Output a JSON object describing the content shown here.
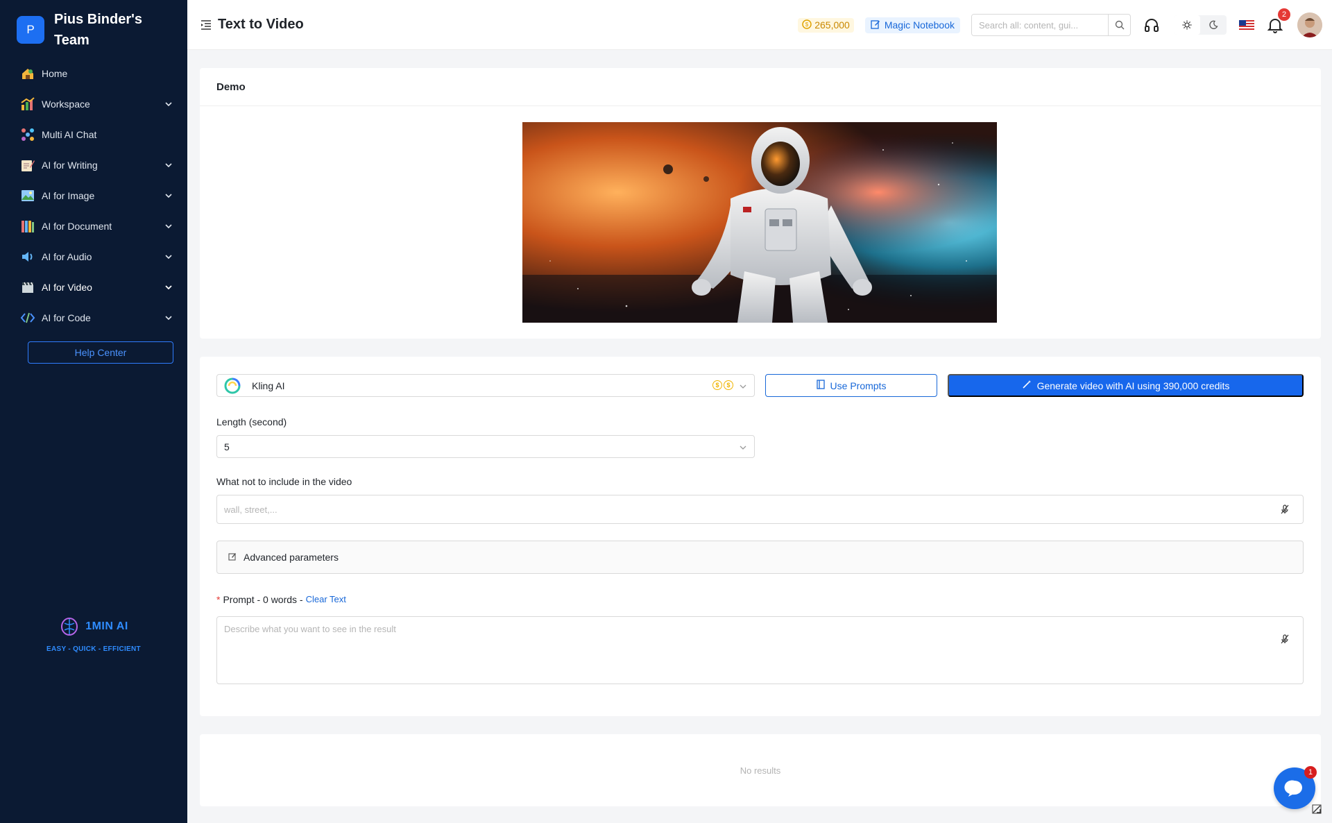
{
  "sidebar": {
    "team_initial": "P",
    "team_name": "Pius Binder's Team",
    "items": [
      {
        "label": "Home",
        "icon": "home-icon",
        "expandable": false
      },
      {
        "label": "Workspace",
        "icon": "workspace-icon",
        "expandable": true
      },
      {
        "label": "Multi AI Chat",
        "icon": "multi-chat-icon",
        "expandable": false
      },
      {
        "label": "AI for Writing",
        "icon": "writing-icon",
        "expandable": true
      },
      {
        "label": "AI for Image",
        "icon": "image-icon",
        "expandable": true
      },
      {
        "label": "AI for Document",
        "icon": "document-icon",
        "expandable": true
      },
      {
        "label": "AI for Audio",
        "icon": "audio-icon",
        "expandable": true
      },
      {
        "label": "AI for Video",
        "icon": "video-icon",
        "expandable": true,
        "active": true
      },
      {
        "label": "AI for Code",
        "icon": "code-icon",
        "expandable": true
      }
    ],
    "help_label": "Help Center",
    "brand_name": "1MIN AI",
    "brand_tagline": "EASY - QUICK - EFFICIENT"
  },
  "header": {
    "title": "Text to Video",
    "credits": "265,000",
    "notebook_label": "Magic Notebook",
    "search_placeholder": "Search all: content, gui...",
    "notification_count": "2"
  },
  "demo": {
    "title": "Demo",
    "image_alt": "astronaut floating in colorful nebula"
  },
  "form": {
    "model_name": "Kling AI",
    "use_prompts_label": "Use Prompts",
    "generate_label": "Generate video with AI using 390,000 credits",
    "length_label": "Length (second)",
    "length_value": "5",
    "negative_label": "What not to include in the video",
    "negative_placeholder": "wall, street,...",
    "advanced_label": "Advanced parameters",
    "prompt_label": "Prompt - 0 words -",
    "prompt_required_mark": "*",
    "clear_text_label": "Clear Text",
    "prompt_placeholder": "Describe what you want to see in the result"
  },
  "results": {
    "empty_text": "No results"
  },
  "chat": {
    "badge_count": "1"
  },
  "colors": {
    "sidebar_bg": "#0b1a33",
    "primary": "#1767ec",
    "brand": "#2f8cff"
  }
}
